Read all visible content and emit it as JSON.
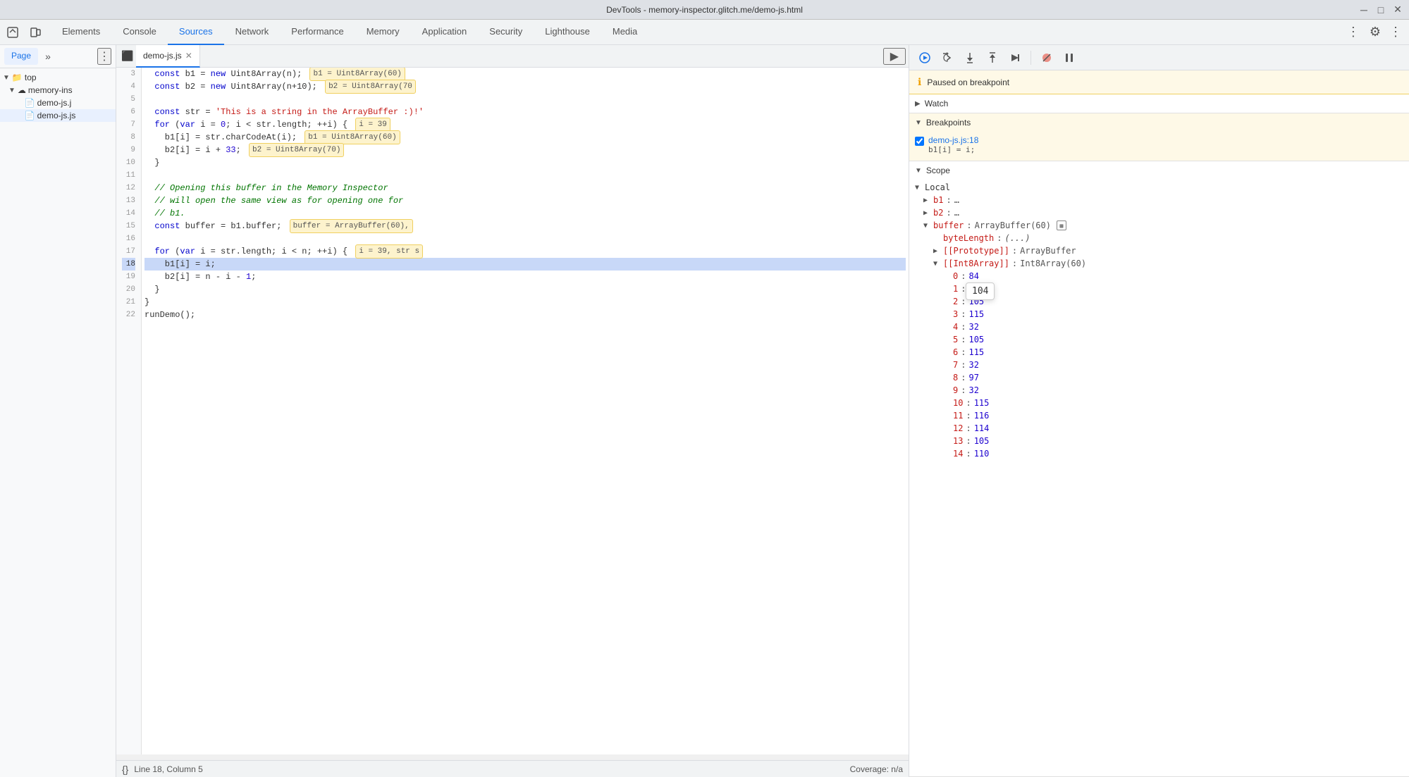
{
  "titlebar": {
    "title": "DevTools - memory-inspector.glitch.me/demo-js.html",
    "min_label": "─",
    "max_label": "□",
    "close_label": "✕"
  },
  "nav": {
    "tabs": [
      {
        "label": "Elements",
        "active": false
      },
      {
        "label": "Console",
        "active": false
      },
      {
        "label": "Sources",
        "active": true
      },
      {
        "label": "Network",
        "active": false
      },
      {
        "label": "Performance",
        "active": false
      },
      {
        "label": "Memory",
        "active": false
      },
      {
        "label": "Application",
        "active": false
      },
      {
        "label": "Security",
        "active": false
      },
      {
        "label": "Lighthouse",
        "active": false
      },
      {
        "label": "Media",
        "active": false
      }
    ]
  },
  "file_tree": {
    "page_tab": "Page",
    "items": [
      {
        "label": "top",
        "type": "folder",
        "expanded": true,
        "indent": 0
      },
      {
        "label": "memory-ins",
        "type": "cloud-folder",
        "expanded": true,
        "indent": 1
      },
      {
        "label": "demo-js.j",
        "type": "file-inactive",
        "indent": 2
      },
      {
        "label": "demo-js.js",
        "type": "file-active",
        "indent": 2
      }
    ]
  },
  "editor": {
    "tab_label": "demo-js.js",
    "lines": [
      {
        "num": 3,
        "tokens": "  const b1 = new Uint8Array(n);  b1 = Uint8Array(60)"
      },
      {
        "num": 4,
        "tokens": "  const b2 = new Uint8Array(n+10);  b2 = Uint8Array(70"
      },
      {
        "num": 5,
        "tokens": ""
      },
      {
        "num": 6,
        "tokens": "  const str = 'This is a string in the ArrayBuffer :)!'"
      },
      {
        "num": 7,
        "tokens": "  for (var i = 0; i < str.length; ++i) {  i = 39"
      },
      {
        "num": 8,
        "tokens": "    b1[i] = str.charCodeAt(i);  b1 = Uint8Array(60)"
      },
      {
        "num": 9,
        "tokens": "    b2[i] = i + 33;  b2 = Uint8Array(70)"
      },
      {
        "num": 10,
        "tokens": "  }"
      },
      {
        "num": 11,
        "tokens": ""
      },
      {
        "num": 12,
        "tokens": "  // Opening this buffer in the Memory Inspector"
      },
      {
        "num": 13,
        "tokens": "  // will open the same view as for opening one for"
      },
      {
        "num": 14,
        "tokens": "  // b1."
      },
      {
        "num": 15,
        "tokens": "  const buffer = b1.buffer;  buffer = ArrayBuffer(60),"
      },
      {
        "num": 16,
        "tokens": ""
      },
      {
        "num": 17,
        "tokens": "  for (var i = str.length; i < n; ++i) {  i = 39, str s"
      },
      {
        "num": 18,
        "tokens": "    b1[i] = i;",
        "highlighted": true
      },
      {
        "num": 19,
        "tokens": "    b2[i] = n - i - 1;"
      },
      {
        "num": 20,
        "tokens": "  }"
      },
      {
        "num": 21,
        "tokens": "}"
      },
      {
        "num": 22,
        "tokens": "runDemo();"
      }
    ],
    "status": {
      "line_col": "Line 18, Column 5",
      "coverage": "Coverage: n/a"
    }
  },
  "debugger": {
    "toolbar": {
      "resume_title": "Resume script execution (F8)",
      "step_over_title": "Step over next function call (F10)",
      "step_into_title": "Step into next function call (F11)",
      "step_out_title": "Step out of current function (Shift+F11)",
      "step_title": "Step (F9)",
      "deactivate_title": "Deactivate breakpoints",
      "pause_exceptions_title": "Pause on caught exceptions"
    },
    "paused_notice": "Paused on breakpoint",
    "sections": {
      "watch": {
        "label": "Watch",
        "expanded": true
      },
      "breakpoints": {
        "label": "Breakpoints",
        "expanded": true,
        "items": [
          {
            "checked": true,
            "filename": "demo-js.js:18",
            "code": "b1[i] = i;"
          }
        ]
      },
      "scope": {
        "label": "Scope",
        "expanded": true,
        "local_label": "Local",
        "items": [
          {
            "indent": 1,
            "chevron": "▶",
            "key": "b1",
            "val": "…"
          },
          {
            "indent": 1,
            "chevron": "▶",
            "key": "b2",
            "val": "…"
          },
          {
            "indent": 1,
            "chevron": "▼",
            "key": "buffer",
            "val": "ArrayBuffer(60)",
            "mem_icon": true
          },
          {
            "indent": 2,
            "chevron": "",
            "key": "byteLength",
            "val": "(...)"
          },
          {
            "indent": 2,
            "chevron": "▶",
            "key": "[[Prototype]]",
            "val": "ArrayBuffer"
          },
          {
            "indent": 2,
            "chevron": "▼",
            "key": "[[Int8Array]]",
            "val": "Int8Array(60)"
          },
          {
            "indent": 3,
            "chevron": "",
            "key": "0",
            "val": "84"
          },
          {
            "indent": 3,
            "chevron": "",
            "key": "1",
            "val": "104",
            "tooltip": true
          },
          {
            "indent": 3,
            "chevron": "",
            "key": "2",
            "val": "105"
          },
          {
            "indent": 3,
            "chevron": "",
            "key": "3",
            "val": "115"
          },
          {
            "indent": 3,
            "chevron": "",
            "key": "4",
            "val": "32"
          },
          {
            "indent": 3,
            "chevron": "",
            "key": "5",
            "val": "105"
          },
          {
            "indent": 3,
            "chevron": "",
            "key": "6",
            "val": "115"
          },
          {
            "indent": 3,
            "chevron": "",
            "key": "7",
            "val": "32"
          },
          {
            "indent": 3,
            "chevron": "",
            "key": "8",
            "val": "97"
          },
          {
            "indent": 3,
            "chevron": "",
            "key": "9",
            "val": "32"
          },
          {
            "indent": 3,
            "chevron": "",
            "key": "10",
            "val": "115"
          },
          {
            "indent": 3,
            "chevron": "",
            "key": "11",
            "val": "116"
          },
          {
            "indent": 3,
            "chevron": "",
            "key": "12",
            "val": "114"
          },
          {
            "indent": 3,
            "chevron": "",
            "key": "13",
            "val": "105"
          },
          {
            "indent": 3,
            "chevron": "",
            "key": "14",
            "val": "110"
          }
        ]
      }
    },
    "tooltip_val": "104"
  }
}
